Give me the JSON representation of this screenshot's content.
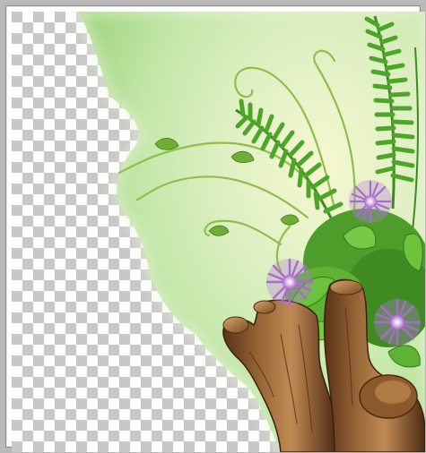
{
  "image": {
    "width": 475,
    "height": 506,
    "frame_color": "#b9b9b9",
    "transparency_checker": {
      "light": "#ffffff",
      "dark": "#c8c8c8"
    },
    "scene": {
      "background_gradient": [
        "#f7f8cf",
        "#d7efbf",
        "#bfe6a7",
        "#9fd77f"
      ],
      "elements": [
        "tree-stump",
        "fern-fronds",
        "purple-thistle-flowers",
        "curly-vines",
        "leaves"
      ]
    }
  }
}
